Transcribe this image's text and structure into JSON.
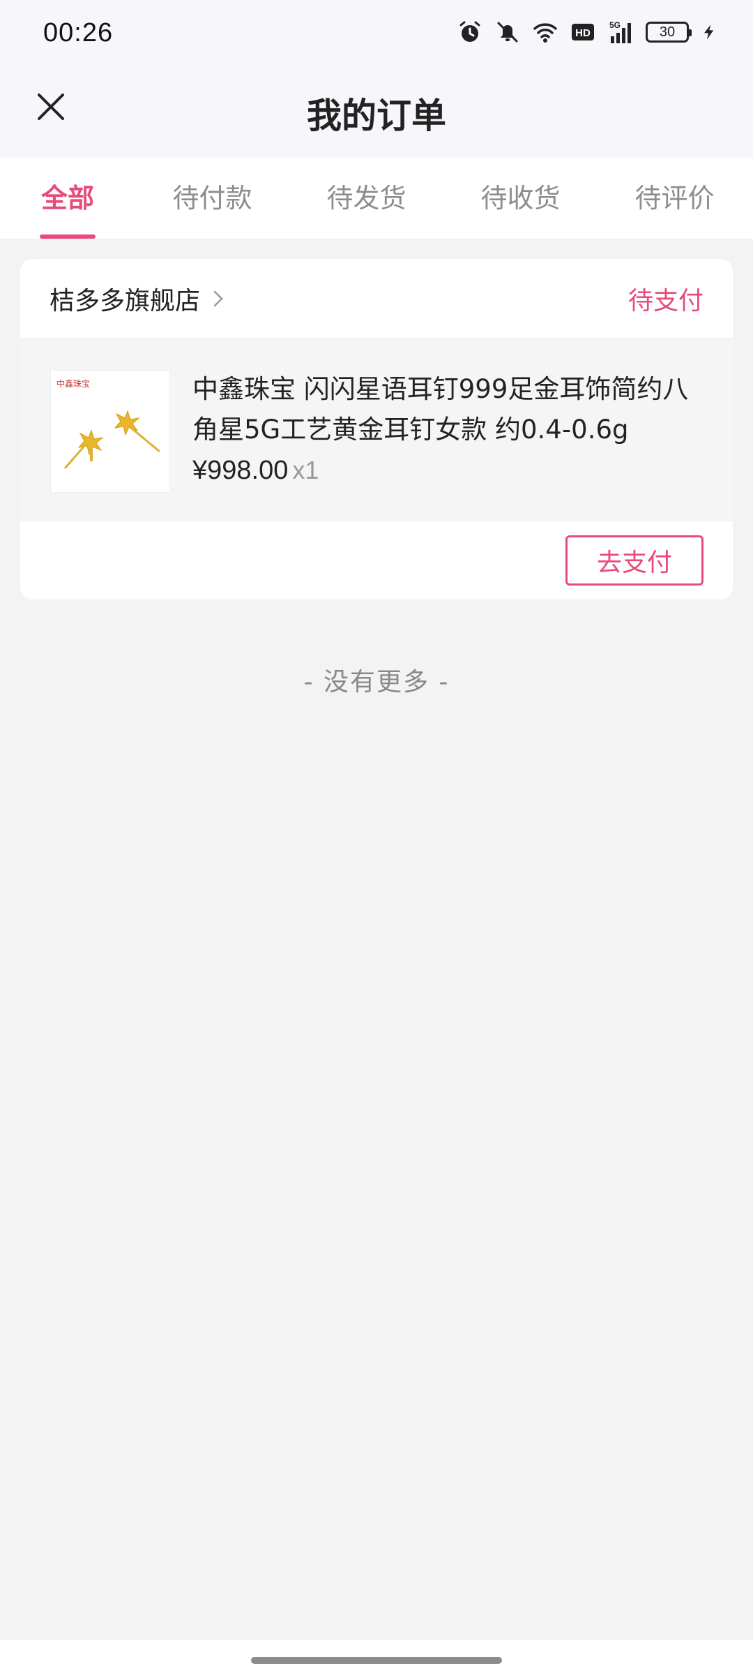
{
  "status_bar": {
    "time": "00:26",
    "battery": "30",
    "icons": [
      "alarm-icon",
      "mute-icon",
      "wifi-icon",
      "hd-icon",
      "5g-signal-icon",
      "battery-icon",
      "charging-icon"
    ]
  },
  "header": {
    "title": "我的订单"
  },
  "tabs": [
    {
      "label": "全部",
      "active": true
    },
    {
      "label": "待付款",
      "active": false
    },
    {
      "label": "待发货",
      "active": false
    },
    {
      "label": "待收货",
      "active": false
    },
    {
      "label": "待评价",
      "active": false
    }
  ],
  "order": {
    "store_name": "桔多多旗舰店",
    "status": "待支付",
    "product": {
      "brand_text": "中鑫珠宝",
      "title": "中鑫珠宝 闪闪星语耳钉999足金耳饰简约八角星5G工艺黄金耳钉女款 约0.4-0.6g",
      "price": "¥998.00",
      "quantity": "x1"
    },
    "pay_button": "去支付"
  },
  "footer_note": "- 没有更多 -",
  "colors": {
    "accent": "#e94a7a",
    "header_bg": "#f6f6fb",
    "page_bg": "#f3f3f3"
  }
}
